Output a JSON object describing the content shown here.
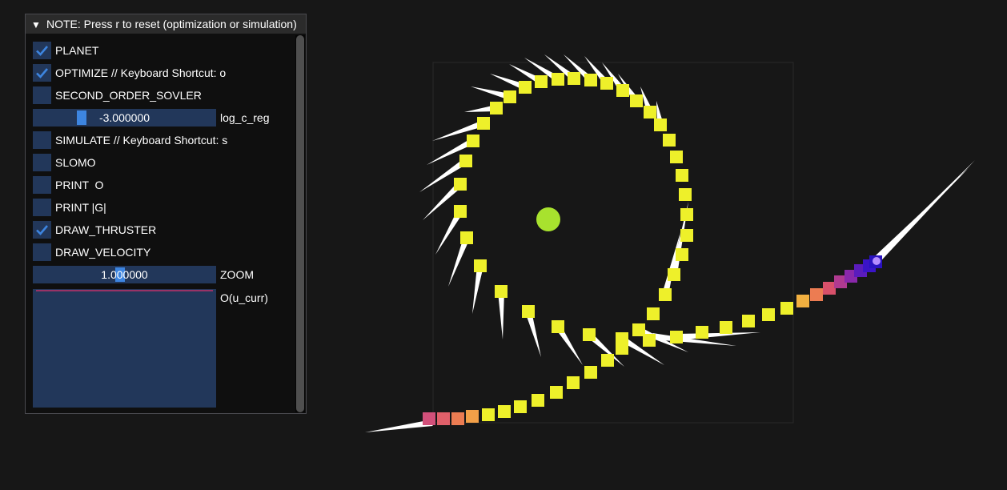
{
  "panel": {
    "header_arrow": "▼",
    "title": "NOTE: Press r to reset (optimization or simulation)",
    "checkboxes": [
      {
        "label": "PLANET",
        "checked": true
      },
      {
        "label": "OPTIMIZE // Keyboard Shortcut: o",
        "checked": true
      },
      {
        "label": "SECOND_ORDER_SOVLER",
        "checked": false
      }
    ],
    "slider_log_c_reg": {
      "value": "-3.000000",
      "label": "log_c_reg"
    },
    "checkboxes2": [
      {
        "label": "SIMULATE // Keyboard Shortcut: s",
        "checked": false
      },
      {
        "label": "SLOMO",
        "checked": false
      },
      {
        "label": "PRINT  O",
        "checked": false
      },
      {
        "label": "PRINT |G|",
        "checked": false
      },
      {
        "label": "DRAW_THRUSTER",
        "checked": true
      },
      {
        "label": "DRAW_VELOCITY",
        "checked": false
      }
    ],
    "slider_zoom": {
      "value": "1.000000",
      "label": "ZOOM"
    },
    "plot": {
      "label": "O(u_curr)"
    }
  },
  "colors": {
    "accent": "#3d85e0",
    "frame_bg": "#22375a",
    "trajectory": "#eef02a",
    "planet": "#a8e22e",
    "thruster": "#ffffff",
    "plot_line": "#c0306a"
  }
}
